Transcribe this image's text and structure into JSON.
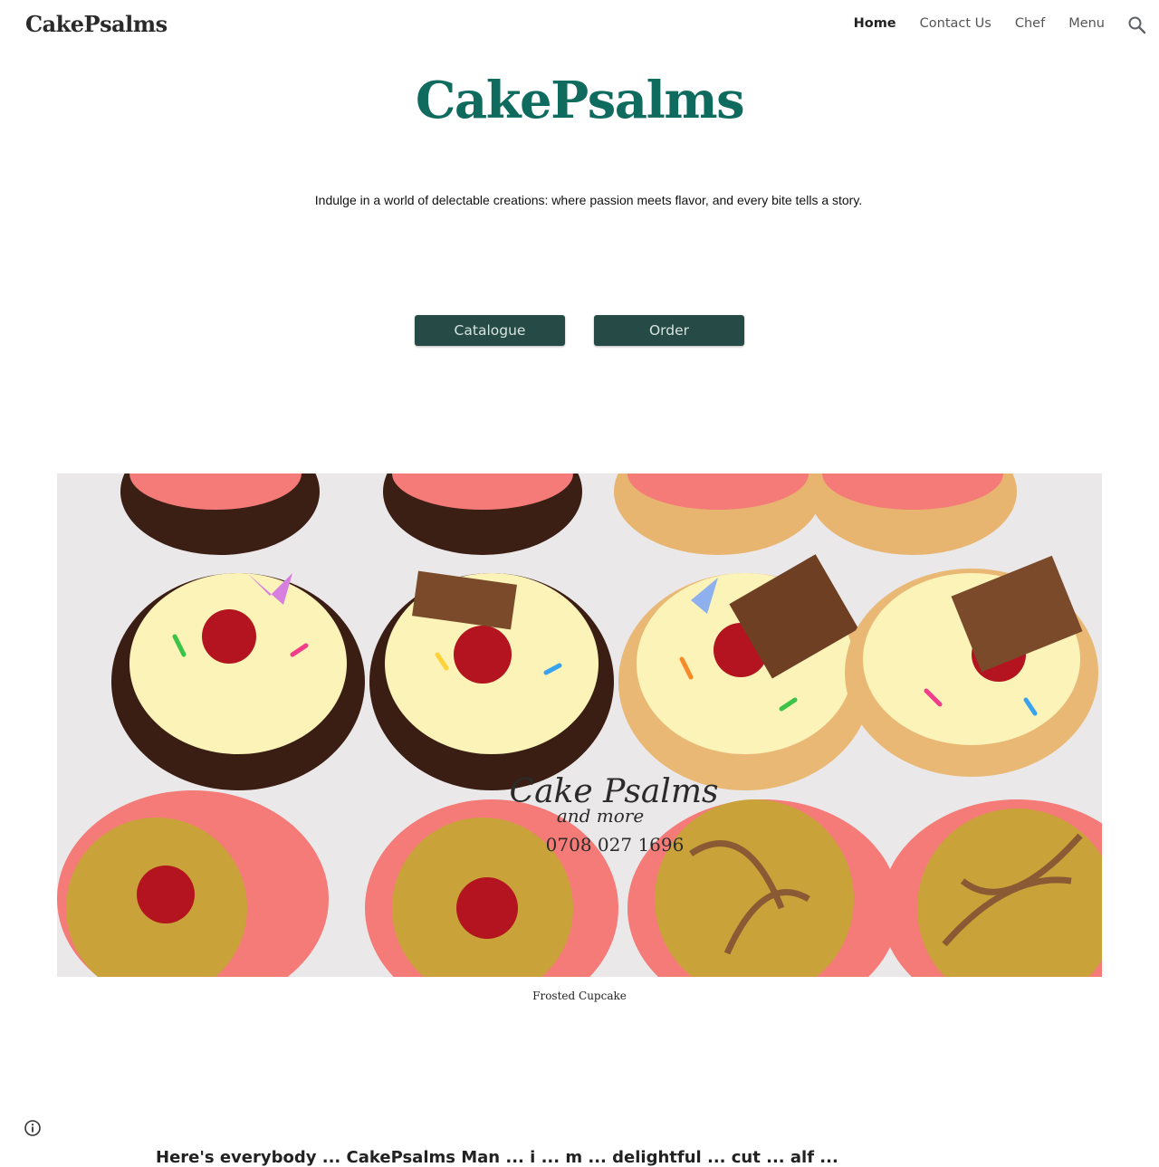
{
  "header": {
    "site_name": "CakePsalms",
    "nav": [
      {
        "label": "Home",
        "active": true
      },
      {
        "label": "Contact Us",
        "active": false
      },
      {
        "label": "Chef",
        "active": false
      },
      {
        "label": "Menu",
        "active": false
      }
    ],
    "search_icon": "search-icon"
  },
  "hero": {
    "title": "CakePsalms",
    "tagline": "Indulge in a world of delectable creations: where passion meets flavor, and every bite tells a story.",
    "buttons": {
      "catalogue": "Catalogue",
      "order": "Order"
    }
  },
  "photo": {
    "watermark_line1": "Cake Psalms",
    "watermark_line2": "and more",
    "watermark_phone": "0708 027 1696",
    "caption": "Frosted Cupcake"
  },
  "bottom": {
    "partial_text": "Here's everybody ... CakePsalms Man ... i ... m ... delightful ... cut ... alf ... "
  },
  "colors": {
    "title": "#0f6b5e",
    "button_bg": "#264a45",
    "button_text": "#d8e4e1"
  },
  "footer": {
    "info_icon": "info-icon"
  }
}
